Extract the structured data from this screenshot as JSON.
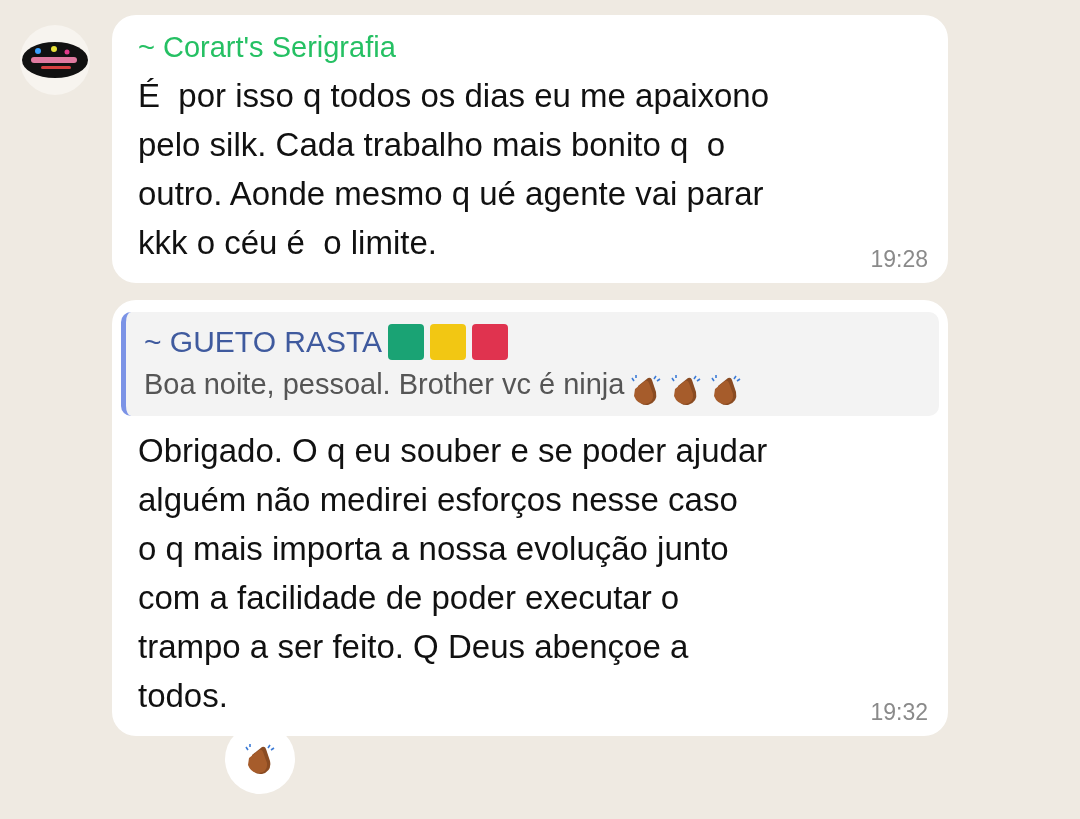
{
  "messages": [
    {
      "kind": "text",
      "sender": "~ Corart's Serigrafia",
      "show_avatar": true,
      "text": "É  por isso q todos os dias eu me apaixono\npelo silk. Cada trabalho mais bonito q  o\noutro. Aonde mesmo q ué agente vai parar\nkkk o céu é  o limite.",
      "time": "19:28"
    },
    {
      "kind": "reply",
      "show_avatar": false,
      "quote": {
        "sender": "~ GUETO RASTA",
        "flags": [
          {
            "color": "#1aa374"
          },
          {
            "color": "#f2c713"
          },
          {
            "color": "#e0334f"
          }
        ],
        "text": "Boa noite, pessoal. Brother vc é ninja"
      },
      "text": "Obrigado. O q eu souber e se poder ajudar\nalguém não medirei esforços nesse caso\no q mais importa a nossa evolução junto\ncom a facilidade de poder executar o\ntrampo a ser feito. Q Deus abençoe a\ntodos.",
      "time": "19:32",
      "reaction": true
    }
  ]
}
